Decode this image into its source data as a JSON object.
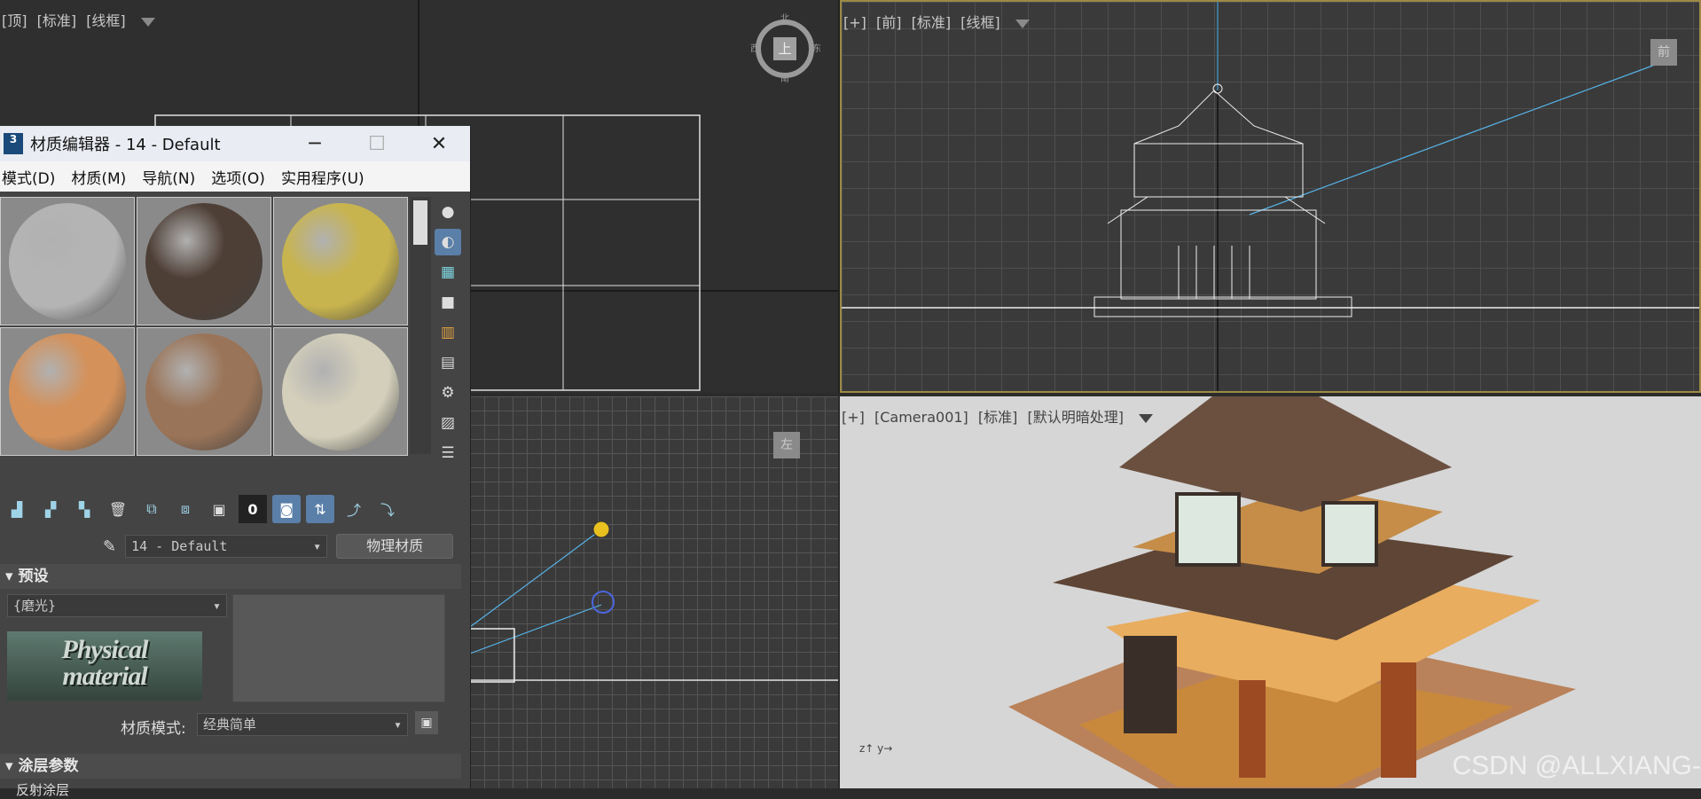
{
  "viewports": {
    "top": {
      "tags": [
        "[顶]",
        "[标准]",
        "[线框]"
      ],
      "cube_face": "上",
      "compass": [
        "北",
        "南",
        "西",
        "东"
      ]
    },
    "front": {
      "tags": [
        "[+]",
        "[前]",
        "[标准]",
        "[线框]"
      ],
      "cube_face": "前"
    },
    "left": {
      "cube_face": "左"
    },
    "camera": {
      "tags": [
        "[+]",
        "[Camera001]",
        "[标准]",
        "[默认明暗处理]"
      ]
    }
  },
  "material_editor": {
    "title": "材质编辑器 - 14 - Default",
    "app_icon": "3",
    "window_buttons": [
      "─",
      "☐",
      "✕"
    ],
    "menu": [
      "模式(D)",
      "材质(M)",
      "导航(N)",
      "选项(O)",
      "实用程序(U)"
    ],
    "spheres": [
      {
        "color": "#b4b4b4"
      },
      {
        "color": "#4e3f36"
      },
      {
        "color": "#c8b44e"
      },
      {
        "color": "#d4915a"
      },
      {
        "color": "#9a7458"
      },
      {
        "color": "#d3cfbb"
      }
    ],
    "material_name": "14 - Default",
    "material_type_button": "物理材质",
    "preset_rollout": "预设",
    "preset_value": "{磨光}",
    "logo_text_line1": "Physical",
    "logo_text_line2": "material",
    "material_mode_label": "材质模式:",
    "material_mode_value": "经典简单",
    "coating_rollout": "涂层参数",
    "reflection_label": "反射涂层",
    "toolbar_slot_number": "0"
  },
  "watermark": "CSDN @ALLXIANG-"
}
